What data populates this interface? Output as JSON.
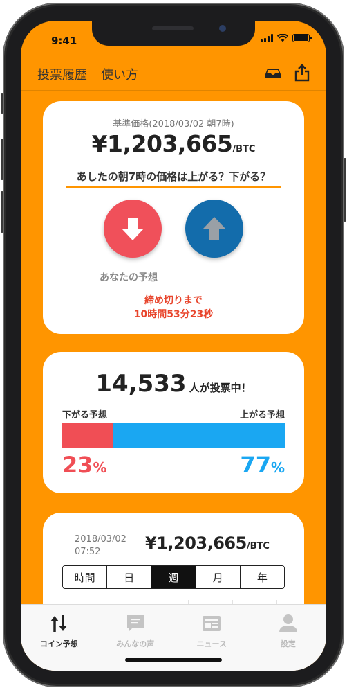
{
  "status_bar": {
    "time": "9:41"
  },
  "header": {
    "history_label": "投票履歴",
    "howto_label": "使い方",
    "icons": [
      "inbox-icon",
      "share-icon"
    ]
  },
  "prediction_card": {
    "base_label": "基準価格(2018/03/02 朝7時)",
    "price": "¥1,203,665",
    "unit": "/BTC",
    "question": "あしたの朝7時の価格は上がる？下がる？",
    "your_prediction_label": "あなたの予想",
    "deadline_line1": "締め切りまで",
    "deadline_line2": "10時間53分23秒",
    "down_button_color": "#F0505A",
    "up_button_color": "#136CAB"
  },
  "stats_card": {
    "voters_count": "14,533",
    "voters_text": "人が投票中！",
    "down_label": "下がる予想",
    "up_label": "上がる予想",
    "down_percent": 23,
    "up_percent": 77,
    "down_percent_text": "23",
    "up_percent_text": "77",
    "percent_symbol": "%",
    "down_color": "#F04E55",
    "up_color": "#1AA7F2"
  },
  "chart_card": {
    "date": "2018/03/02",
    "time": "07:52",
    "price": "¥1,203,665",
    "unit": "/BTC",
    "tabs": [
      {
        "label": "時間",
        "active": false
      },
      {
        "label": "日",
        "active": false
      },
      {
        "label": "週",
        "active": true
      },
      {
        "label": "月",
        "active": false
      },
      {
        "label": "年",
        "active": false
      }
    ]
  },
  "tab_bar": {
    "items": [
      {
        "label": "コイン予想",
        "icon": "up-down-arrows-icon",
        "active": true
      },
      {
        "label": "みんなの声",
        "icon": "chat-bubble-icon",
        "active": false
      },
      {
        "label": "ニュース",
        "icon": "newspaper-icon",
        "active": false
      },
      {
        "label": "設定",
        "icon": "person-icon",
        "active": false
      }
    ]
  },
  "colors": {
    "accent": "#FF9500"
  }
}
